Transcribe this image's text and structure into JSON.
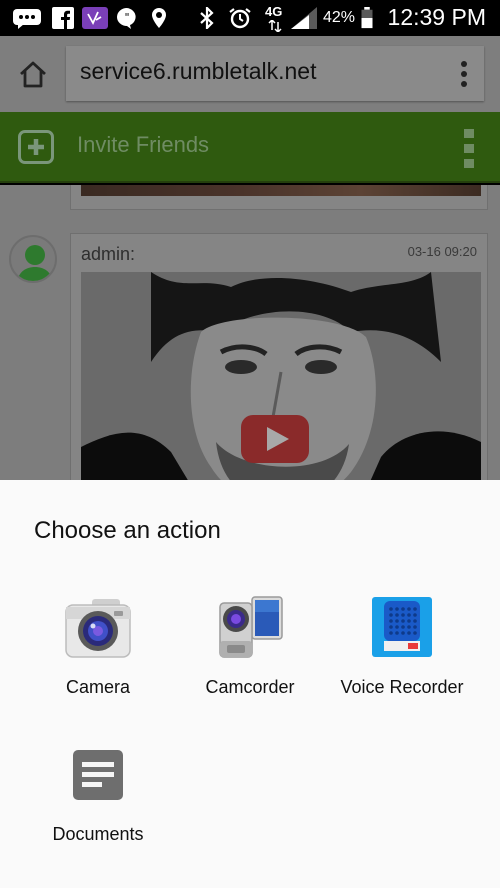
{
  "status_bar": {
    "battery_percent": "42%",
    "network": "4G",
    "time": "12:39 PM"
  },
  "browser": {
    "url": "service6.rumbletalk.net"
  },
  "app_header": {
    "title": "Invite Friends"
  },
  "chat": {
    "message": {
      "user": "admin:",
      "timestamp": "03-16 09:20"
    }
  },
  "sheet": {
    "title": "Choose an action",
    "options": [
      {
        "label": "Camera",
        "icon": "camera-icon"
      },
      {
        "label": "Camcorder",
        "icon": "camcorder-icon"
      },
      {
        "label": "Voice Recorder",
        "icon": "voice-recorder-icon"
      },
      {
        "label": "Documents",
        "icon": "documents-icon"
      }
    ]
  }
}
